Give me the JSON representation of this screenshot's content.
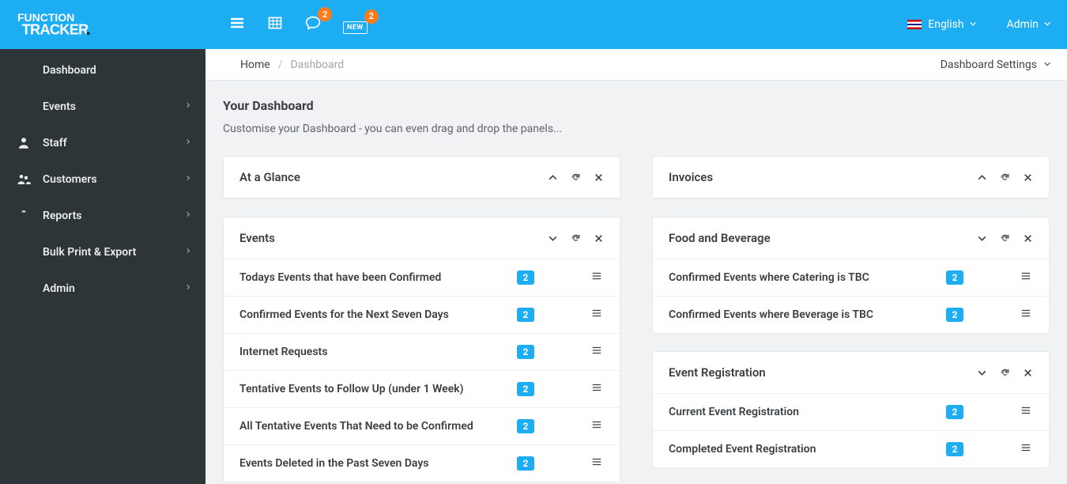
{
  "topbar": {
    "chat_badge": "2",
    "new_label": "NEW",
    "new_badge": "2",
    "lang_label": "English",
    "user_label": "Admin"
  },
  "sidebar": {
    "items": [
      {
        "label": "Dashboard",
        "expandable": false,
        "icon": "home"
      },
      {
        "label": "Events",
        "expandable": true,
        "icon": "calendar"
      },
      {
        "label": "Staff",
        "expandable": true,
        "icon": "person"
      },
      {
        "label": "Customers",
        "expandable": true,
        "icon": "people"
      },
      {
        "label": "Reports",
        "expandable": true,
        "icon": "clipboard"
      },
      {
        "label": "Bulk Print & Export",
        "expandable": true,
        "icon": "printer"
      },
      {
        "label": "Admin",
        "expandable": true,
        "icon": "gear"
      }
    ]
  },
  "breadcrumb": {
    "home": "Home",
    "current": "Dashboard",
    "settings": "Dashboard Settings"
  },
  "page": {
    "title": "Your Dashboard",
    "subtitle": "Customise your Dashboard - you can even drag and drop the panels..."
  },
  "panels": {
    "left": [
      {
        "title": "At a Glance",
        "collapsed": false,
        "rows": []
      },
      {
        "title": "Events",
        "collapsed": true,
        "rows": [
          {
            "label": "Todays Events that have been Confirmed",
            "count": "2"
          },
          {
            "label": "Confirmed Events for the Next Seven Days",
            "count": "2"
          },
          {
            "label": "Internet Requests",
            "count": "2"
          },
          {
            "label": "Tentative Events to Follow Up (under 1 Week)",
            "count": "2"
          },
          {
            "label": "All Tentative Events That Need to be Confirmed",
            "count": "2"
          },
          {
            "label": "Events Deleted in the Past Seven Days",
            "count": "2"
          }
        ]
      }
    ],
    "right": [
      {
        "title": "Invoices",
        "collapsed": false,
        "rows": []
      },
      {
        "title": "Food and Beverage",
        "collapsed": true,
        "rows": [
          {
            "label": "Confirmed Events where Catering is TBC",
            "count": "2"
          },
          {
            "label": "Confirmed Events where Beverage is TBC",
            "count": "2"
          }
        ]
      },
      {
        "title": "Event Registration",
        "collapsed": true,
        "rows": [
          {
            "label": "Current Event Registration",
            "count": "2"
          },
          {
            "label": "Completed Event Registration",
            "count": "2"
          }
        ]
      }
    ]
  }
}
